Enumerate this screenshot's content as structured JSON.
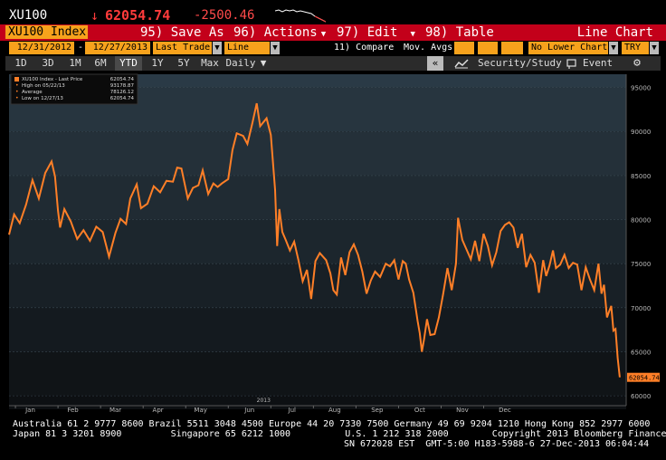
{
  "header": {
    "ticker": "XU100",
    "price_arrow": "↓",
    "price": "62054.74",
    "change": "-2500.46"
  },
  "toolbar": {
    "security": "XU100 Index",
    "save_as": "95) Save As",
    "actions": "96) Actions",
    "edit": "97) Edit",
    "table": "98) Table",
    "line_chart": "Line Chart"
  },
  "controls": {
    "start_date": "12/31/2012",
    "dash": "-",
    "end_date": "12/27/2013",
    "field": "Last Trade",
    "chart_style": "Line",
    "compare": "11) Compare",
    "mov_avgs": "Mov. Avgs",
    "lower_chart": "No Lower Chart",
    "currency": "TRY"
  },
  "period_bar": {
    "periods": [
      "1D",
      "3D",
      "1M",
      "6M",
      "YTD",
      "1Y",
      "5Y",
      "Max"
    ],
    "active": "YTD",
    "frequency": "Daily",
    "collapse": "«",
    "security_study": "Security/Study",
    "event": "Event",
    "settings_icon": "gear-icon"
  },
  "legend": {
    "rows": [
      {
        "label": "XU100 Index - Last Price",
        "value": "62054.74"
      },
      {
        "label": "High on 05/22/13",
        "value": "93178.87"
      },
      {
        "label": "Average",
        "value": "78126.12"
      },
      {
        "label": "Low on 12/27/13",
        "value": "62054.74"
      }
    ]
  },
  "chart_data": {
    "type": "line",
    "title": "",
    "xlabel": "",
    "ylabel": "",
    "ylim": [
      59500,
      96500
    ],
    "y_ticks": [
      "95000",
      "90000",
      "85000",
      "80000",
      "75000",
      "70000",
      "65000",
      "60000"
    ],
    "x_ticks": [
      "Jan",
      "Feb",
      "Mar",
      "Apr",
      "May",
      "Jun",
      "Jul",
      "Aug",
      "Sep",
      "Oct",
      "Nov",
      "Dec"
    ],
    "x_year_labels": [
      "2013"
    ],
    "last_price_label": "62054.74",
    "line_color": "#ff7f27",
    "series": [
      {
        "name": "XU100 Index - Last Price",
        "points": [
          [
            0.0,
            78300
          ],
          [
            0.12,
            80600
          ],
          [
            0.25,
            79600
          ],
          [
            0.4,
            81700
          ],
          [
            0.55,
            84500
          ],
          [
            0.7,
            82400
          ],
          [
            0.85,
            85300
          ],
          [
            1.0,
            86600
          ],
          [
            1.08,
            84900
          ],
          [
            1.15,
            81000
          ],
          [
            1.2,
            79100
          ],
          [
            1.3,
            81200
          ],
          [
            1.45,
            79800
          ],
          [
            1.6,
            77800
          ],
          [
            1.75,
            78800
          ],
          [
            1.9,
            77600
          ],
          [
            2.05,
            79200
          ],
          [
            2.2,
            78600
          ],
          [
            2.35,
            75800
          ],
          [
            2.5,
            78500
          ],
          [
            2.62,
            80100
          ],
          [
            2.75,
            79500
          ],
          [
            2.85,
            82400
          ],
          [
            3.0,
            84000
          ],
          [
            3.1,
            81300
          ],
          [
            3.25,
            81800
          ],
          [
            3.4,
            83800
          ],
          [
            3.55,
            83100
          ],
          [
            3.7,
            84400
          ],
          [
            3.85,
            84300
          ],
          [
            3.95,
            85900
          ],
          [
            4.05,
            85800
          ],
          [
            4.2,
            82400
          ],
          [
            4.32,
            83600
          ],
          [
            4.45,
            83900
          ],
          [
            4.55,
            85600
          ],
          [
            4.68,
            82900
          ],
          [
            4.8,
            84100
          ],
          [
            4.9,
            83700
          ],
          [
            5.0,
            84100
          ],
          [
            5.15,
            84600
          ],
          [
            5.25,
            87900
          ],
          [
            5.35,
            89800
          ],
          [
            5.5,
            89500
          ],
          [
            5.6,
            88600
          ],
          [
            5.72,
            91000
          ],
          [
            5.82,
            93200
          ],
          [
            5.9,
            90600
          ],
          [
            6.05,
            91500
          ],
          [
            6.15,
            89600
          ],
          [
            6.25,
            83400
          ],
          [
            6.3,
            77000
          ],
          [
            6.35,
            81200
          ],
          [
            6.42,
            78600
          ],
          [
            6.5,
            77700
          ],
          [
            6.6,
            76500
          ],
          [
            6.7,
            77500
          ],
          [
            6.8,
            75400
          ],
          [
            6.9,
            73000
          ],
          [
            7.0,
            74300
          ],
          [
            7.1,
            71000
          ],
          [
            7.2,
            75300
          ],
          [
            7.3,
            76200
          ],
          [
            7.45,
            75400
          ],
          [
            7.55,
            73900
          ],
          [
            7.62,
            72000
          ],
          [
            7.7,
            71500
          ],
          [
            7.8,
            75700
          ],
          [
            7.9,
            73700
          ],
          [
            8.0,
            76300
          ],
          [
            8.1,
            77200
          ],
          [
            8.2,
            76000
          ],
          [
            8.3,
            74100
          ],
          [
            8.4,
            71600
          ],
          [
            8.5,
            73100
          ],
          [
            8.6,
            74100
          ],
          [
            8.72,
            73500
          ],
          [
            8.85,
            75000
          ],
          [
            8.95,
            74700
          ],
          [
            9.05,
            75400
          ],
          [
            9.15,
            73200
          ],
          [
            9.25,
            75300
          ],
          [
            9.32,
            75000
          ],
          [
            9.4,
            73200
          ],
          [
            9.5,
            71700
          ],
          [
            9.6,
            68500
          ],
          [
            9.65,
            67100
          ],
          [
            9.7,
            65000
          ],
          [
            9.75,
            66400
          ],
          [
            9.82,
            68700
          ],
          [
            9.9,
            66900
          ],
          [
            10.0,
            67000
          ],
          [
            10.1,
            68900
          ],
          [
            10.2,
            71600
          ],
          [
            10.3,
            74500
          ],
          [
            10.4,
            72000
          ],
          [
            10.5,
            75000
          ],
          [
            10.55,
            80200
          ],
          [
            10.65,
            77700
          ],
          [
            10.75,
            76600
          ],
          [
            10.85,
            75500
          ],
          [
            10.95,
            77600
          ],
          [
            11.05,
            75300
          ],
          [
            11.15,
            78400
          ],
          [
            11.25,
            77000
          ],
          [
            11.35,
            74800
          ],
          [
            11.45,
            76300
          ],
          [
            11.55,
            78700
          ],
          [
            11.65,
            79400
          ],
          [
            11.75,
            79700
          ],
          [
            11.85,
            79100
          ],
          [
            11.95,
            76800
          ],
          [
            12.05,
            78400
          ],
          [
            12.15,
            74600
          ],
          [
            12.25,
            76000
          ],
          [
            12.35,
            75100
          ],
          [
            12.45,
            71700
          ],
          [
            12.55,
            75400
          ],
          [
            12.62,
            73600
          ],
          [
            12.7,
            74800
          ],
          [
            12.78,
            76500
          ],
          [
            12.85,
            74500
          ],
          [
            12.95,
            74900
          ],
          [
            13.05,
            76000
          ],
          [
            13.15,
            74500
          ],
          [
            13.25,
            75100
          ],
          [
            13.35,
            74900
          ],
          [
            13.45,
            72000
          ],
          [
            13.55,
            74600
          ],
          [
            13.65,
            73200
          ],
          [
            13.75,
            72000
          ],
          [
            13.85,
            75000
          ],
          [
            13.92,
            71600
          ],
          [
            13.98,
            72600
          ],
          [
            14.05,
            68900
          ],
          [
            14.1,
            69600
          ],
          [
            14.15,
            70200
          ],
          [
            14.2,
            67400
          ],
          [
            14.25,
            67600
          ],
          [
            14.3,
            64300
          ],
          [
            14.35,
            62100
          ]
        ]
      }
    ]
  }
}
